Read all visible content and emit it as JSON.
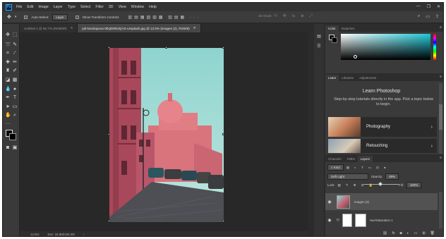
{
  "app": {
    "logo": "Ps",
    "menu": [
      "File",
      "Edit",
      "Image",
      "Layer",
      "Type",
      "Select",
      "Filter",
      "3D",
      "View",
      "Window",
      "Help"
    ],
    "window_controls": [
      "—",
      "❐",
      "✕"
    ]
  },
  "options_bar": {
    "auto_select_label": "Auto-Select:",
    "auto_select_value": "Layer",
    "transform_label": "Show Transform Controls",
    "mode_3d": "3D Mode:",
    "right_icons": [
      "search-icon",
      "workspace-icon",
      "share-icon"
    ]
  },
  "tabs": [
    {
      "label": "Untitled-1 @ 66.7% (RGB/8#)",
      "active": false
    },
    {
      "label": "juli-kosolapova-0bQD8N3QAS-unsplash.jpg @ 12.5% (Images (2), RGB/8)",
      "active": true
    }
  ],
  "status": {
    "zoom": "12.5%",
    "doc": "Doc: 34.9M/100.2M"
  },
  "color_panel": {
    "tabs": [
      "Color",
      "Swatches"
    ],
    "hue_color": "#21c8d8"
  },
  "learn_panel": {
    "tabs": [
      "Learn",
      "Libraries",
      "Adjustments"
    ],
    "title": "Learn Photoshop",
    "description": "Step-by-step tutorials directly in the app. Pick a topic below to begin.",
    "cards": [
      {
        "label": "Photography"
      },
      {
        "label": "Retouching"
      }
    ]
  },
  "layers_panel": {
    "tabs": [
      "Channels",
      "Paths",
      "Layers"
    ],
    "filter_kind": "Kind",
    "blend_mode": "Soft Light",
    "opacity_label": "Opacity:",
    "opacity_value": "49%",
    "lock_label": "Lock:",
    "fill_label": "Fill:",
    "fill_value": "100%",
    "layers": [
      {
        "name": "Images (2)",
        "selected": true
      },
      {
        "name": "Hue/Saturation 1",
        "selected": false
      }
    ],
    "bottom_icons": [
      "link-icon",
      "fx-icon",
      "mask-icon",
      "adjustment-icon",
      "folder-icon",
      "new-layer-icon",
      "trash-icon"
    ]
  }
}
